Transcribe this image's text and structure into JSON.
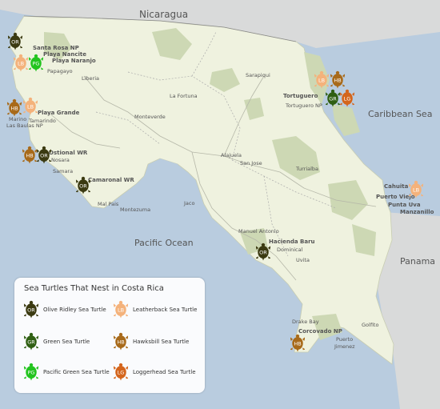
{
  "countries": {
    "nicaragua": "Nicaragua",
    "panama": "Panama"
  },
  "seas": {
    "caribbean": "Caribbean Sea",
    "pacific": "Pacific Ocean"
  },
  "places": {
    "santa_rosa": "Santa Rosa NP",
    "playa_nancite": "Playa Nancite",
    "playa_naranjo": "Playa Naranjo",
    "papagayo": "Papagayo",
    "liberia": "Liberia",
    "playa_grande": "Playa Grande",
    "marino_1": "Marino",
    "marino_2": "Las Baulas NP",
    "tamarindo": "Tamarindo",
    "ostional": "Ostional WR",
    "nosara": "Nosara",
    "samara": "Samara",
    "camaronal": "Camaronal WR",
    "mal_pais": "Mal Pais",
    "montezuma": "Montezuma",
    "la_fortuna": "La Fortuna",
    "monteverde": "Monteverde",
    "sarapiqui": "Sarapiqui",
    "tortuguero": "Tortuguero",
    "tortuguero_np": "Tortuguero NP",
    "alajuela": "Alajuela",
    "san_jose": "San Jose",
    "turrialba": "Turrialba",
    "jaco": "Jaco",
    "cahuita": "Cahuita",
    "puerto_viejo": "Puerto Viejo",
    "punta_uva": "Punta Uva",
    "manzanillo": "Manzanillo",
    "manuel_antonio": "Manuel Antonio",
    "hacienda_baru": "Hacienda Baru",
    "dominical": "Dominical",
    "uvita": "Uvita",
    "drake_bay": "Drake Bay",
    "corcovado": "Corcovado NP",
    "golfito": "Golfito",
    "puerto_1": "Puerto",
    "puerto_2": "Jimenez"
  },
  "markers": [
    {
      "code": "OR",
      "color": "#3b3a11"
    },
    {
      "code": "LB",
      "color": "#f4b27b"
    },
    {
      "code": "PG",
      "color": "#22c41e"
    },
    {
      "code": "HB",
      "color": "#a86a1a"
    },
    {
      "code": "LB",
      "color": "#f4b27b"
    },
    {
      "code": "HB",
      "color": "#a86a1a"
    },
    {
      "code": "OR",
      "color": "#3b3a11"
    },
    {
      "code": "OR",
      "color": "#3b3a11"
    },
    {
      "code": "LB",
      "color": "#f4b27b"
    },
    {
      "code": "HB",
      "color": "#a86a1a"
    },
    {
      "code": "GR",
      "color": "#2f5f12"
    },
    {
      "code": "LG",
      "color": "#d4651c"
    },
    {
      "code": "LB",
      "color": "#f4b27b"
    },
    {
      "code": "OR",
      "color": "#3b3a11"
    },
    {
      "code": "HB",
      "color": "#a86a1a"
    }
  ],
  "legend": {
    "title": "Sea Turtles That Nest in Costa Rica",
    "items": [
      {
        "code": "OR",
        "label": "Olive Ridley Sea Turtle",
        "color": "#3b3a11"
      },
      {
        "code": "LB",
        "label": "Leatherback Sea Turtle",
        "color": "#f4b27b"
      },
      {
        "code": "GR",
        "label": "Green Sea Turtle",
        "color": "#2f5f12"
      },
      {
        "code": "HB",
        "label": "Hawksbill Sea Turtle",
        "color": "#a86a1a"
      },
      {
        "code": "PG",
        "label": "Pacific Green Sea Turtle",
        "color": "#22c41e"
      },
      {
        "code": "LG",
        "label": "Loggerhead Sea Turtle",
        "color": "#d4651c"
      }
    ]
  }
}
